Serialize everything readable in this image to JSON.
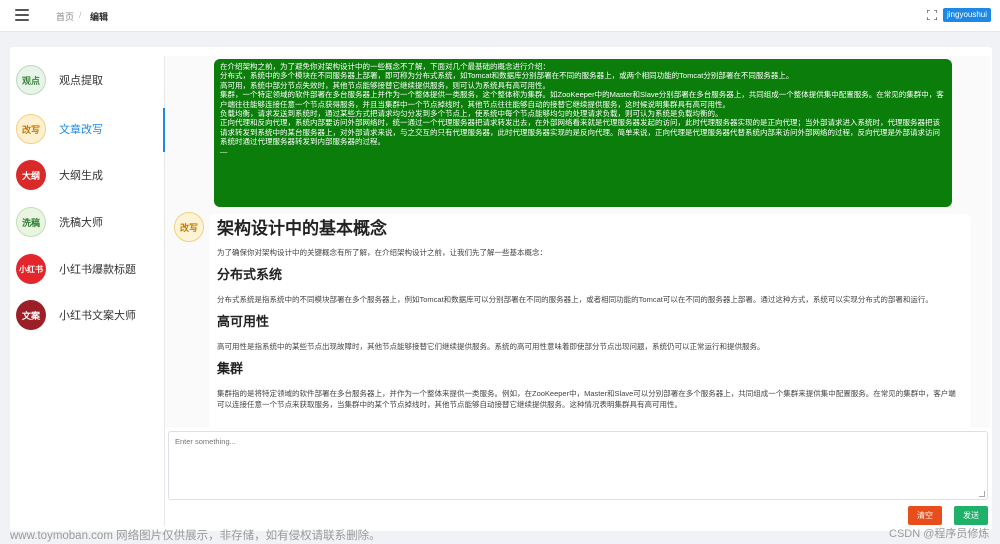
{
  "breadcrumb": {
    "home": "首页",
    "separator": "/",
    "current": "编辑"
  },
  "user": {
    "name": "jingyoushui"
  },
  "sidebar": {
    "active_index": 1,
    "items": [
      {
        "label": "观点提取",
        "icon": "view-extract-logo-icon",
        "icon_text": "观点",
        "color": "#e8f4ea"
      },
      {
        "label": "文章改写",
        "icon": "article-rewrite-logo-icon",
        "icon_text": "改写",
        "color": "#fff1d0"
      },
      {
        "label": "大纲生成",
        "icon": "outline-gen-logo-icon",
        "icon_text": "大纲",
        "color": "#d92a2a"
      },
      {
        "label": "洗稿大师",
        "icon": "rewrite-master-logo-icon",
        "icon_text": "洗稿",
        "color": "#e9f5e0"
      },
      {
        "label": "小红书爆款标题",
        "icon": "xiaohongshu-logo-icon",
        "icon_text": "小红书",
        "color": "#e3262b"
      },
      {
        "label": "小红书文案大师",
        "icon": "xiaohongshu-copy-logo-icon",
        "icon_text": "文案",
        "color": "#9c1f27"
      }
    ]
  },
  "user_message": {
    "lines": [
      "在介绍架构之前，为了避免你对架构设计中的一些概念不了解，下面对几个最基础的概念进行介绍：",
      "分布式，系统中的多个模块在不同服务器上部署，即可称为分布式系统，如Tomcat和数据库分别部署在不同的服务器上，或两个相同功能的Tomcat分别部署在不同服务器上。",
      "高可用，系统中部分节点失效时，其他节点能够接替它继续提供服务，则可认为系统具有高可用性。",
      "集群，一个特定领域的软件部署在多台服务器上并作为一个整体提供一类服务，这个整体称为集群。如ZooKeeper中的Master和Slave分别部署在多台服务器上，共同组成一个整体提供集中配置服务。在常见的集群中，客户端往往能够连接任意一个节点获得服务，并且当集群中一个节点掉线时，其他节点往往能够自动的接替它继续提供服务，这时候说明集群具有高可用性。",
      "负载均衡，请求发送到系统时，通过某些方式把请求均匀分发到多个节点上，使系统中每个节点能够均匀的处理请求负载，则可认为系统是负载均衡的。",
      "正向代理和反向代理，系统内部要访问外部网络时，统一通过一个代理服务器把请求转发出去，在外部网络看来就是代理服务器发起的访问，此时代理服务器实现的是正向代理；当外部请求进入系统时，代理服务器把该请求转发到系统中的某台服务器上，对外部请求来说，与之交互的只有代理服务器，此时代理服务器实现的是反向代理。简单来说，正向代理是代理服务器代替系统内部来访问外部网络的过程，反向代理是外部请求访问系统时通过代理服务器转发到内部服务器的过程。",
      "—"
    ]
  },
  "bot_message": {
    "title": "架构设计中的基本概念",
    "intro": "为了确保你对架构设计中的关键概念有所了解，在介绍架构设计之前，让我们先了解一些基本概念：",
    "sections": [
      {
        "heading": "分布式系统",
        "body": "分布式系统是指系统中的不同模块部署在多个服务器上，例如Tomcat和数据库可以分别部署在不同的服务器上，或者相同功能的Tomcat可以在不同的服务器上部署。通过这种方式，系统可以实现分布式的部署和运行。"
      },
      {
        "heading": "高可用性",
        "body": "高可用性是指系统中的某些节点出现故障时，其他节点能够接替它们继续提供服务。系统的高可用性意味着即使部分节点出现问题，系统仍可以正常运行和提供服务。"
      },
      {
        "heading": "集群",
        "body": "集群指的是将特定领域的软件部署在多台服务器上，并作为一个整体来提供一类服务。例如，在ZooKeeper中，Master和Slave可以分别部署在多个服务器上，共同组成一个集群来提供集中配置服务。在常见的集群中，客户端可以连接任意一个节点来获取服务，当集群中的某个节点掉线时，其他节点能够自动接替它继续提供服务。这种情况表明集群具有高可用性。"
      }
    ]
  },
  "input": {
    "placeholder": "Enter something..."
  },
  "buttons": {
    "clear": "清空",
    "send": "发送"
  },
  "watermark": {
    "left": "www.toymoban.com 网络图片仅供展示，非存储，如有侵权请联系删除。",
    "right": "CSDN @程序员修炼"
  }
}
